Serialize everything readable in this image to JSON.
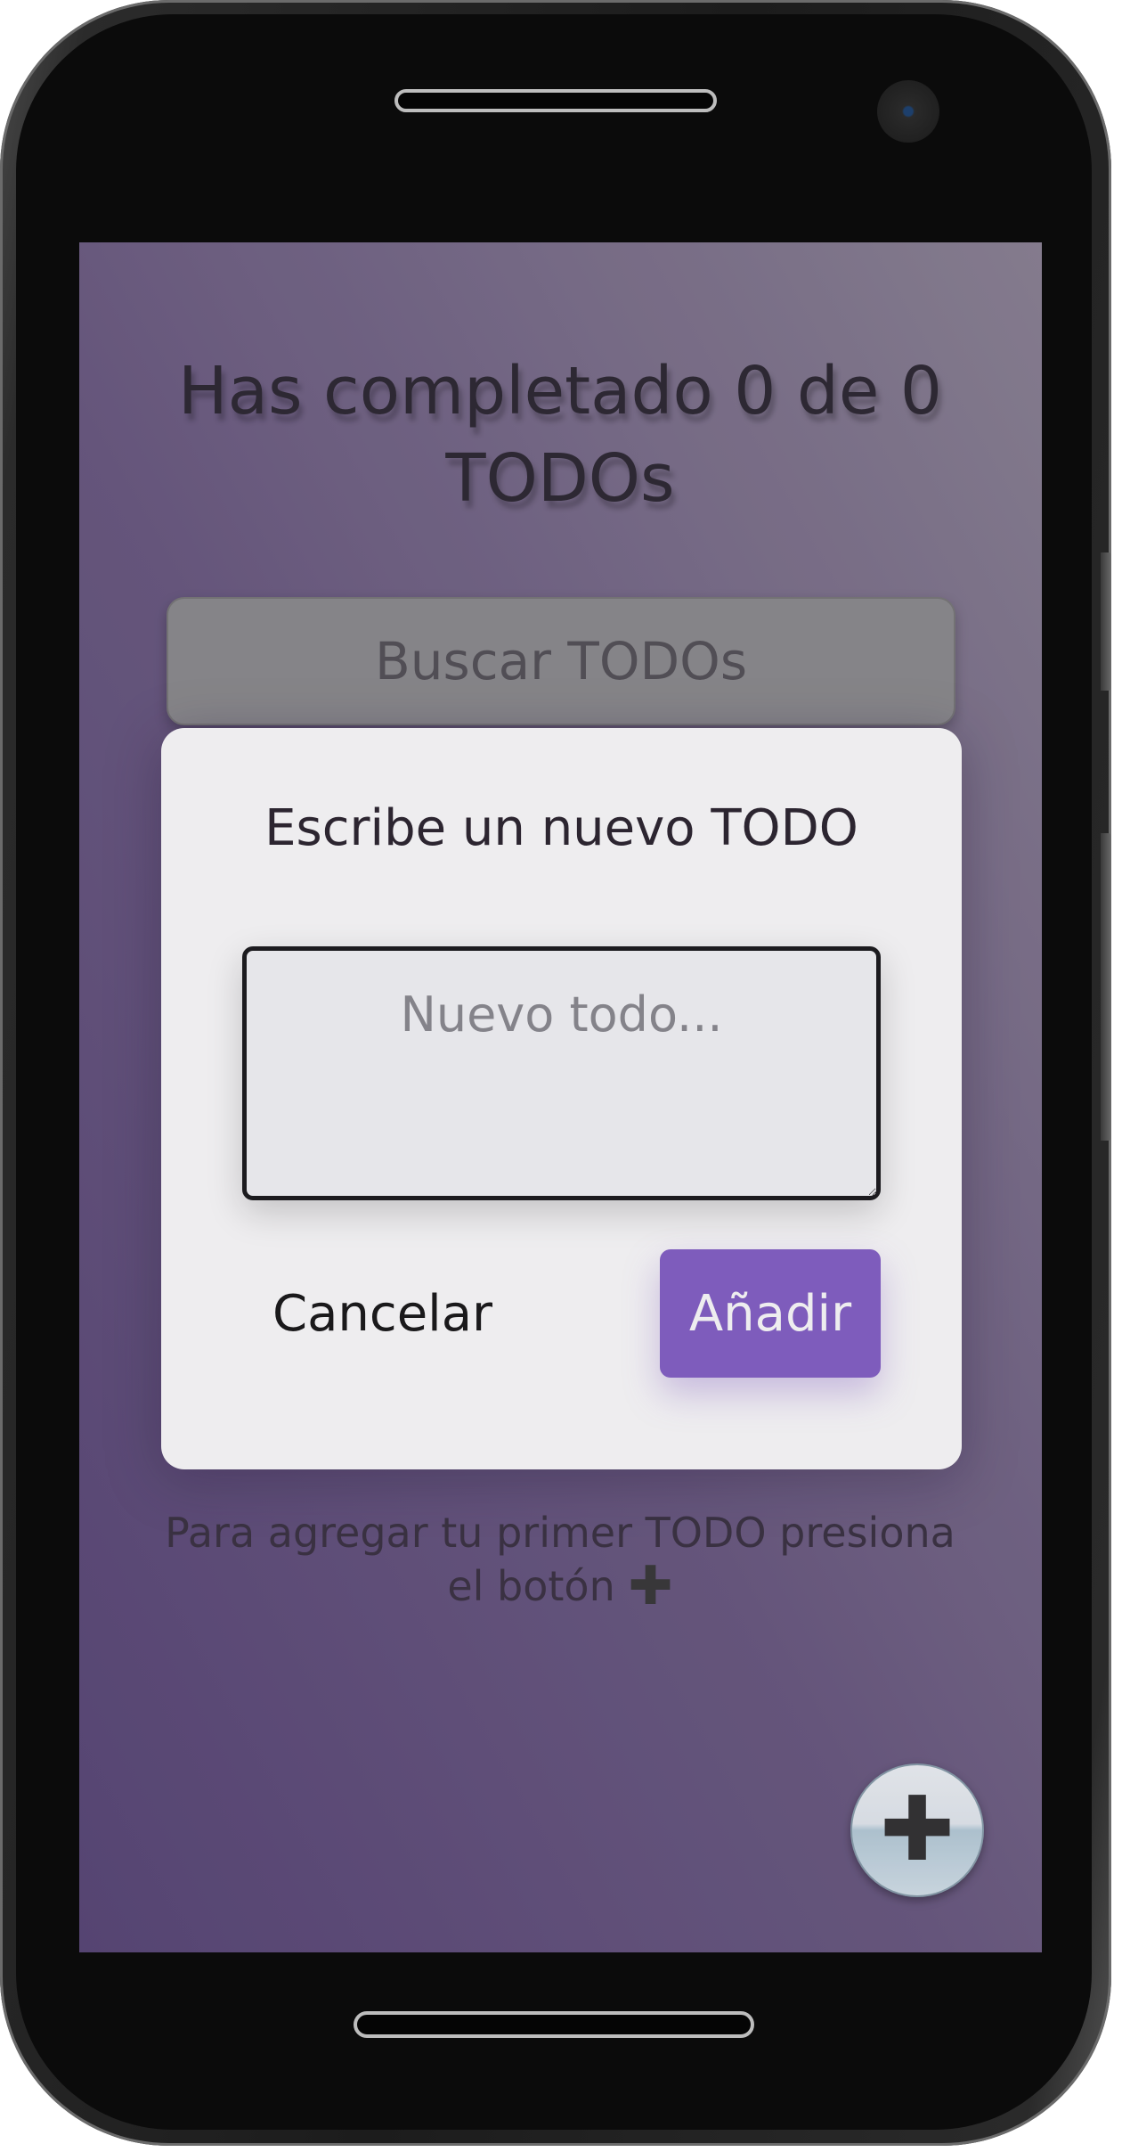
{
  "app": {
    "counter_title": "Has completado 0 de 0 TODOs",
    "search": {
      "placeholder": "Buscar TODOs"
    },
    "empty_hint": {
      "text": "Para agregar tu primer TODO presiona el botón",
      "icon": "plus-icon"
    },
    "fab": {
      "icon": "plus-icon",
      "glyph": "✚"
    }
  },
  "modal": {
    "title": "Escribe un nuevo TODO",
    "textarea": {
      "placeholder": "Nuevo todo...",
      "value": ""
    },
    "cancel_label": "Cancelar",
    "add_label": "Añadir"
  },
  "colors": {
    "accent": "#8662c8",
    "background_start": "#5a4878",
    "background_end": "#8c8495",
    "modal_bg": "#ffffff"
  }
}
